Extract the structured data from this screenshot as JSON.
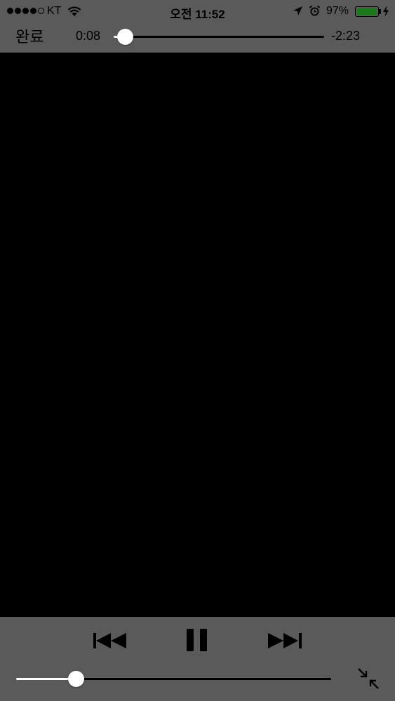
{
  "status_bar": {
    "signal_bars_filled": 4,
    "signal_bars_total": 5,
    "carrier": "KT",
    "time": "오전 11:52",
    "battery_percent": "97%",
    "battery_level": 0.97,
    "icons": [
      "wifi-icon",
      "location-arrow-icon",
      "alarm-clock-icon",
      "battery-icon",
      "charging-bolt-icon"
    ]
  },
  "player": {
    "done_label": "완료",
    "elapsed": "0:08",
    "remaining": "-2:23",
    "progress": 0.054
  },
  "controls": {
    "icons": [
      "skip-back-icon",
      "pause-icon",
      "skip-forward-icon",
      "exit-fullscreen-icon"
    ],
    "volume_level": 0.19
  },
  "colors": {
    "bar_background": "#5a5a5a",
    "video_background": "#000000",
    "slider_fill": "#ffffff",
    "battery_fill": "#1a7a1a"
  }
}
